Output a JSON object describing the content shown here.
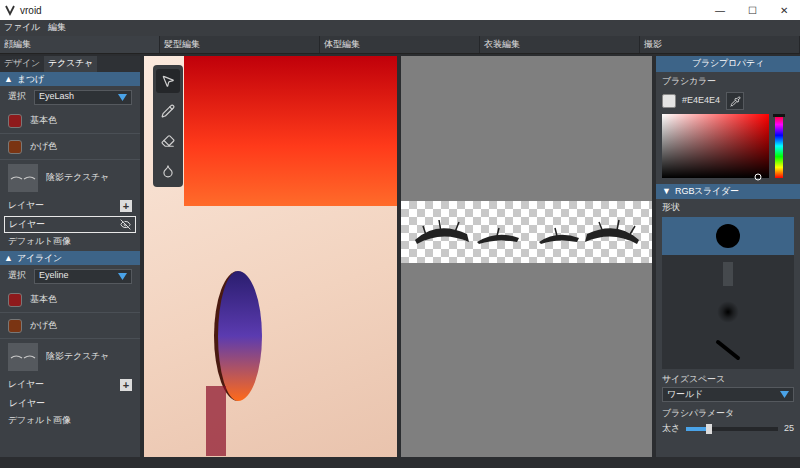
{
  "window": {
    "title": "vroid",
    "controls": [
      "—",
      "☐",
      "✕"
    ]
  },
  "menu": [
    "ファイル",
    "編集"
  ],
  "modes": [
    {
      "label": "顔編集",
      "selected": true
    },
    {
      "label": "髪型編集",
      "selected": false
    },
    {
      "label": "体型編集",
      "selected": false
    },
    {
      "label": "衣装編集",
      "selected": false
    },
    {
      "label": "撮影",
      "selected": false
    }
  ],
  "left_panel": {
    "tabs": [
      {
        "label": "デザイン",
        "selected": false
      },
      {
        "label": "テクスチャ",
        "selected": true
      }
    ],
    "sections": [
      {
        "title": "まつげ",
        "toggle": "▲",
        "expanded": true,
        "select_label": "選択",
        "select_value": "EyeLash",
        "colors": [
          {
            "label": "基本色",
            "color": "#8e1a1c"
          },
          {
            "label": "かげ色",
            "color": "#7a3412"
          }
        ],
        "texture_label": "陰影テクスチャ",
        "layers_label": "レイヤー",
        "add": "+",
        "layers": [
          {
            "label": "レイヤー",
            "selected": true,
            "hidden": true
          }
        ],
        "default_label": "デフォルト画像"
      },
      {
        "title": "アイライン",
        "toggle": "▲",
        "expanded": true,
        "select_label": "選択",
        "select_value": "Eyeline",
        "colors": [
          {
            "label": "基本色",
            "color": "#8e1a1c"
          },
          {
            "label": "かげ色",
            "color": "#7a3412"
          }
        ],
        "texture_label": "陰影テクスチャ",
        "layers_label": "レイヤー",
        "add": "+",
        "layers": [
          {
            "label": "レイヤー",
            "selected": false,
            "hidden": false
          }
        ],
        "default_label": "デフォルト画像"
      }
    ]
  },
  "tools": [
    {
      "kind": "select",
      "selected": true
    },
    {
      "kind": "pen",
      "selected": false
    },
    {
      "kind": "eraser",
      "selected": false
    },
    {
      "kind": "fill",
      "selected": false
    }
  ],
  "brush": {
    "header": "ブラシプロパティ",
    "color_label": "ブラシカラー",
    "hex": "#E4E4E4",
    "color": "#e4e4e4",
    "picker": {
      "saturation": 0.9,
      "value": 0.02,
      "hue_level": 0
    },
    "rgb_toggle": "▼",
    "rgb_label": "RGBスライダー",
    "rgb_expanded": false,
    "shape_label": "形状",
    "shapes": [
      {
        "kind": "circle",
        "selected": true
      },
      {
        "kind": "bar",
        "selected": false
      },
      {
        "kind": "soft",
        "selected": false
      },
      {
        "kind": "line",
        "selected": false
      }
    ],
    "size_space_label": "サイズスペース",
    "size_space": "ワールド",
    "params_label": "ブラシパラメータ",
    "params": [
      {
        "label": "太さ",
        "level": 0.25,
        "reading": "25"
      }
    ]
  }
}
